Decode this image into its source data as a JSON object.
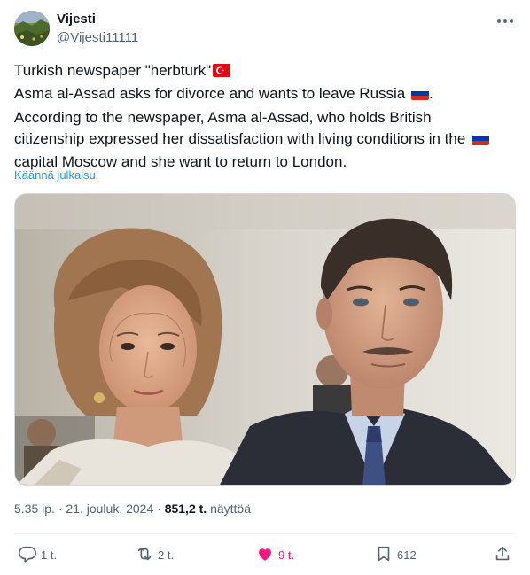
{
  "author": {
    "display_name": "Vijesti",
    "handle": "@Vijesti11111"
  },
  "tweet": {
    "lines": [
      "Turkish newspaper \"herbturk\"",
      "Asma al-Assad asks for divorce and wants to leave Russia",
      "According to the newspaper, Asma al-Assad, who holds British",
      "citizenship expressed her dissatisfaction with living conditions in the",
      "capital Moscow and she want to return to London."
    ],
    "line2_tail": ".",
    "translate_link": "Käännä julkaisu"
  },
  "meta": {
    "time": "5.35 ip.",
    "separator": "·",
    "date": "21. jouluk. 2024",
    "views_count": "851,2 t.",
    "views_label": "näyttöä"
  },
  "actions": {
    "reply_count": "1 t.",
    "repost_count": "2 t.",
    "like_count": "9 t.",
    "bookmark_count": "612"
  },
  "icons": {
    "more": "more-options-icon",
    "reply": "reply-icon",
    "repost": "repost-icon",
    "like": "heart-icon",
    "bookmark": "bookmark-icon",
    "share": "share-icon",
    "flag_turkey": "turkey-flag-icon",
    "flag_russia": "russia-flag-icon"
  },
  "colors": {
    "text": "#0f1419",
    "secondary": "#536471",
    "link": "#1d9bf0",
    "like": "#f91880",
    "border": "#cfd9de"
  }
}
